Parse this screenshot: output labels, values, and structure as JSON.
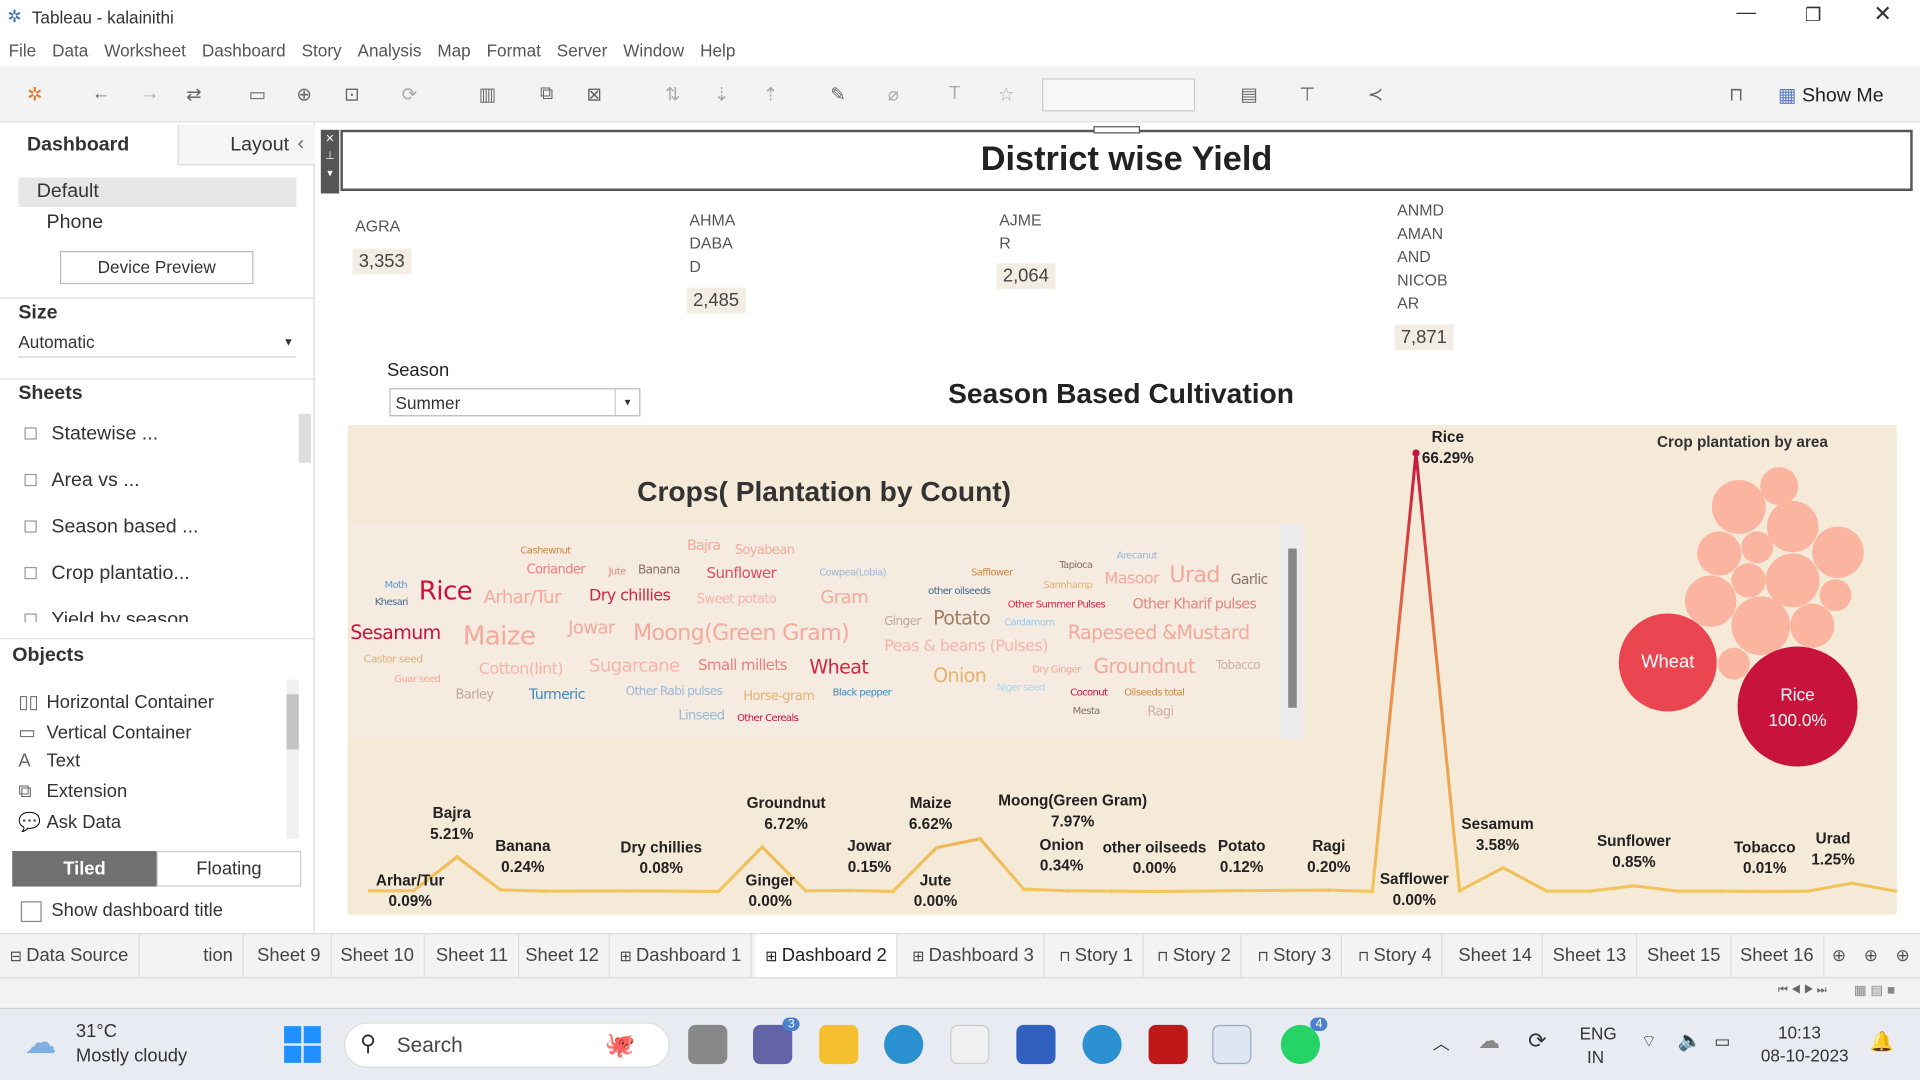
{
  "window": {
    "title": "Tableau - kalainithi"
  },
  "menu": [
    "File",
    "Data",
    "Worksheet",
    "Dashboard",
    "Story",
    "Analysis",
    "Map",
    "Format",
    "Server",
    "Window",
    "Help"
  ],
  "toolbar": {
    "show_me": "Show Me"
  },
  "left": {
    "tabs": [
      "Dashboard",
      "Layout"
    ],
    "devices": [
      "Default",
      "Phone"
    ],
    "device_preview": "Device Preview",
    "size_label": "Size",
    "size_value": "Automatic",
    "sheets_label": "Sheets",
    "sheets": [
      "Statewise ...",
      "Area vs ...",
      "Season based ...",
      "Crop plantatio...",
      "Yield by season"
    ],
    "objects_label": "Objects",
    "objects": [
      "Horizontal Container",
      "Vertical Container",
      "Text",
      "Extension",
      "Ask Data"
    ],
    "tiled": "Tiled",
    "floating": "Floating",
    "show_title": "Show dashboard title"
  },
  "dashboard": {
    "title": "District wise Yield",
    "kpis": [
      {
        "label": [
          "AGRA"
        ],
        "value": "3,353"
      },
      {
        "label": [
          "AHMA",
          "DABA",
          "D"
        ],
        "value": "2,485"
      },
      {
        "label": [
          "AJME",
          "R"
        ],
        "value": "2,064"
      },
      {
        "label": [
          "ANMD",
          "AMAN",
          "AND",
          "NICOB",
          "AR"
        ],
        "value": "7,871"
      }
    ],
    "season_label": "Season",
    "season_value": "Summer",
    "subtitle": "Season Based Cultivation",
    "wordcloud_title": "Crops( Plantation by Count)",
    "bubble_title": "Crop plantation by area"
  },
  "wordcloud": [
    "Cashewnut",
    "Bajra",
    "Soyabean",
    "Coriander",
    "Jute",
    "Banana",
    "Sunflower",
    "Cowpea(Lobia)",
    "Safflower",
    "Tapioca",
    "Arecanut",
    "Moth",
    "Khesari",
    "Rice",
    "Arhar/Tur",
    "Dry chillies",
    "Sweet potato",
    "Gram",
    "other oilseeds",
    "Sannhamp",
    "Masoor",
    "Urad",
    "Garlic",
    "Other Summer Pulses",
    "Other Kharif pulses",
    "Sesamum",
    "Maize",
    "Jowar",
    "Moong(Green Gram)",
    "Ginger",
    "Potato",
    "Cardamom",
    "Rapeseed &Mustard",
    "Peas & beans (Pulses)",
    "Castor seed",
    "Cotton(lint)",
    "Sugarcane",
    "Small millets",
    "Wheat",
    "Dry Ginger",
    "Groundnut",
    "Tobacco",
    "Onion",
    "Guar seed",
    "Niger seed",
    "Coconut",
    "Oilseeds total",
    "Barley",
    "Turmeric",
    "Other Rabi pulses",
    "Horse-gram",
    "Black pepper",
    "Mesta",
    "Ragi",
    "Linseed",
    "Other Cereals"
  ],
  "chart_data": [
    {
      "type": "line",
      "title": "Season Based Cultivation (share by crop, %)",
      "ylim": [
        0,
        70
      ],
      "points": [
        {
          "label": "Arhar/Tur",
          "value": 0.09,
          "text": "0.09%"
        },
        {
          "label": null,
          "value": 0.1
        },
        {
          "label": "Bajra",
          "value": 5.21,
          "text": "5.21%"
        },
        {
          "label": "Banana",
          "value": 0.24,
          "text": "0.24%"
        },
        {
          "label": null,
          "value": 0.05
        },
        {
          "label": null,
          "value": 0.06
        },
        {
          "label": "Dry chillies",
          "value": 0.08,
          "text": "0.08%"
        },
        {
          "label": null,
          "value": 0.05
        },
        {
          "label": "Ginger",
          "value": 0.0,
          "text": "0.00%"
        },
        {
          "label": "Groundnut",
          "value": 6.72,
          "text": "6.72%"
        },
        {
          "label": null,
          "value": 0.1
        },
        {
          "label": "Jowar",
          "value": 0.15,
          "text": "0.15%"
        },
        {
          "label": "Jute",
          "value": 0.0,
          "text": "0.00%"
        },
        {
          "label": "Maize",
          "value": 6.62,
          "text": "6.62%"
        },
        {
          "label": "Moong(Green Gram)",
          "value": 7.97,
          "text": "7.97%"
        },
        {
          "label": "Onion",
          "value": 0.34,
          "text": "0.34%"
        },
        {
          "label": null,
          "value": 0.1
        },
        {
          "label": null,
          "value": 0.05
        },
        {
          "label": "other oilseeds",
          "value": 0.0,
          "text": "0.00%"
        },
        {
          "label": null,
          "value": 0.05
        },
        {
          "label": "Potato",
          "value": 0.12,
          "text": "0.12%"
        },
        {
          "label": null,
          "value": 0.15
        },
        {
          "label": "Ragi",
          "value": 0.2,
          "text": "0.20%"
        },
        {
          "label": "Safflower",
          "value": 0.0,
          "text": "0.00%"
        },
        {
          "label": "Rice",
          "value": 66.29,
          "text": "66.29%"
        },
        {
          "label": null,
          "value": 0.1
        },
        {
          "label": "Sesamum",
          "value": 3.58,
          "text": "3.58%"
        },
        {
          "label": null,
          "value": 0.05
        },
        {
          "label": null,
          "value": 0.05
        },
        {
          "label": "Sunflower",
          "value": 0.85,
          "text": "0.85%"
        },
        {
          "label": null,
          "value": 0.05
        },
        {
          "label": null,
          "value": 0.05
        },
        {
          "label": "Tobacco",
          "value": 0.01,
          "text": "0.01%"
        },
        {
          "label": null,
          "value": 0.05
        },
        {
          "label": "Urad",
          "value": 1.25,
          "text": "1.25%"
        },
        {
          "label": null,
          "value": 0.05
        }
      ]
    },
    {
      "type": "bubble",
      "title": "Crop plantation by area",
      "bubbles": [
        {
          "label": "Rice",
          "text": "100.0%",
          "color": "#c8143c"
        },
        {
          "label": "Wheat",
          "color": "#ea4550"
        },
        {
          "count_unlabeled": 13,
          "color": "#fbb4a0"
        }
      ]
    }
  ],
  "sheet_tabs": [
    "Data Source",
    "tion",
    "Sheet 9",
    "Sheet 10",
    "Sheet 11",
    "Sheet 12",
    "Dashboard 1",
    "Dashboard 2",
    "Dashboard 3",
    "Story 1",
    "Story 2",
    "Story 3",
    "Story 4",
    "Sheet 14",
    "Sheet 13",
    "Sheet 15",
    "Sheet 16"
  ],
  "taskbar": {
    "temp": "31°C",
    "weather": "Mostly cloudy",
    "search": "Search",
    "lang1": "ENG",
    "lang2": "IN",
    "time": "10:13",
    "date": "08-10-2023",
    "badge_teams": "3",
    "badge_whatsapp": "4"
  },
  "colors": {
    "rice": "#c8143c",
    "wheat": "#ea4550",
    "bubble": "#fbb4a0",
    "line": "#f2c45a",
    "chart_bg": "#f5e9d8"
  }
}
